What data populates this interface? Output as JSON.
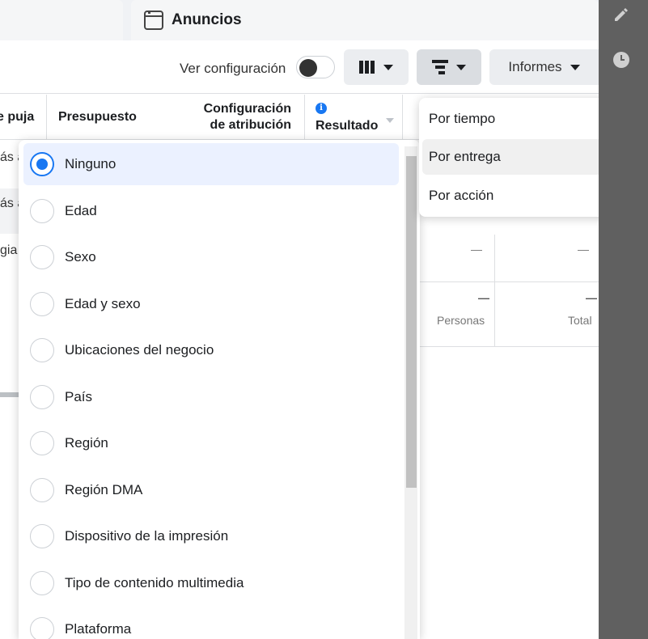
{
  "header": {
    "tab_title": "Anuncios"
  },
  "toolbar": {
    "view_config_label": "Ver configuración",
    "toggle_on": false,
    "reports_label": "Informes"
  },
  "table": {
    "headers": {
      "bid": "e puja",
      "budget": "Presupuesto",
      "attribution_line1": "Configuración",
      "attribution_line2": "de atribución",
      "results": "Resultados"
    },
    "row_fragments": [
      "ás a",
      "ás a",
      "gia"
    ],
    "dash": "—",
    "people_label": "Personas",
    "total_label": "Total"
  },
  "breakdown_dropdown": {
    "options": [
      {
        "label": "Ninguno",
        "selected": true
      },
      {
        "label": "Edad",
        "selected": false
      },
      {
        "label": "Sexo",
        "selected": false
      },
      {
        "label": "Edad y sexo",
        "selected": false
      },
      {
        "label": "Ubicaciones del negocio",
        "selected": false
      },
      {
        "label": "País",
        "selected": false
      },
      {
        "label": "Región",
        "selected": false
      },
      {
        "label": "Región DMA",
        "selected": false
      },
      {
        "label": "Dispositivo de la impresión",
        "selected": false
      },
      {
        "label": "Tipo de contenido multimedia",
        "selected": false
      },
      {
        "label": "Plataforma",
        "selected": false
      }
    ]
  },
  "breakdown_menu": {
    "items": [
      {
        "label": "Por tiempo"
      },
      {
        "label": "Por entrega"
      },
      {
        "label": "Por acción"
      }
    ],
    "hovered_index": 1
  },
  "colors": {
    "accent": "#1877f2",
    "rail": "#606060",
    "selected_bg": "#ebf1ff"
  }
}
